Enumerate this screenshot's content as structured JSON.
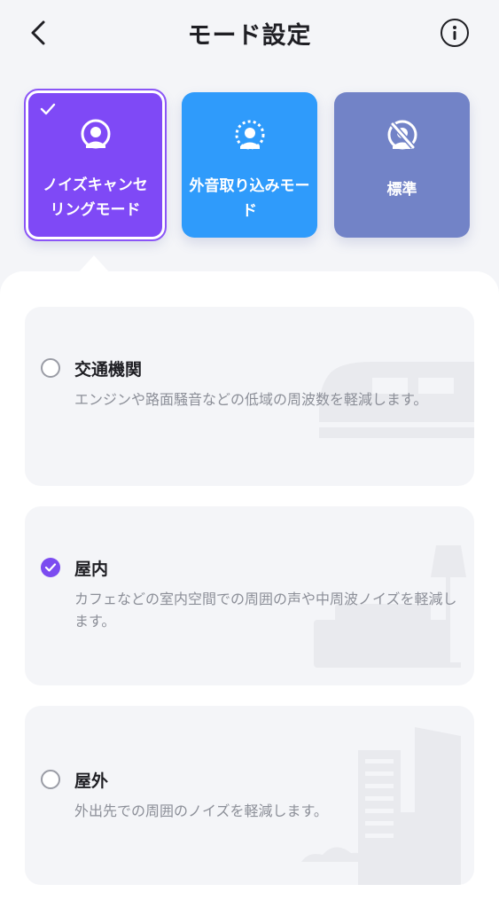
{
  "header": {
    "title": "モード設定"
  },
  "modes": [
    {
      "label": "ノイズキャンセリングモード",
      "icon": "noise-cancel-person-icon",
      "color": "#7f49f6",
      "selected": true
    },
    {
      "label": "外音取り込みモード",
      "icon": "ambient-person-icon",
      "color": "#2f9bfb",
      "selected": false
    },
    {
      "label": "標準",
      "icon": "standard-slash-icon",
      "color": "#7283c7",
      "selected": false
    }
  ],
  "options": [
    {
      "title": "交通機関",
      "description": "エンジンや路面騒音などの低域の周波数を軽減します。",
      "selected": false,
      "illustration": "train-icon"
    },
    {
      "title": "屋内",
      "description": "カフェなどの室内空間での周囲の声や中周波ノイズを軽減します。",
      "selected": true,
      "illustration": "sofa-lamp-icon"
    },
    {
      "title": "屋外",
      "description": "外出先での周囲のノイズを軽減します。",
      "selected": false,
      "illustration": "buildings-icon"
    }
  ],
  "colors": {
    "accent": "#7b4bf0",
    "background": "#f4f5f8"
  }
}
